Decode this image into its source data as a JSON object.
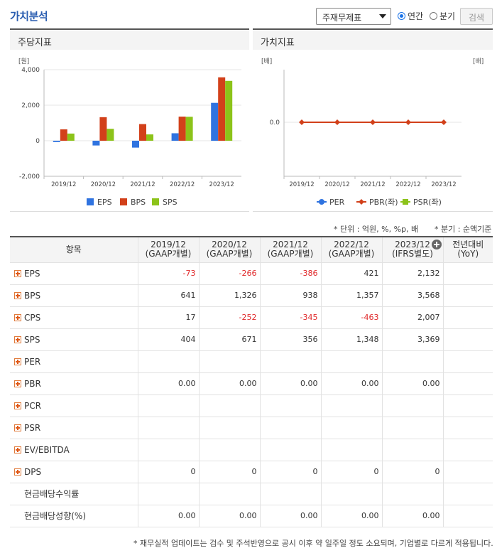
{
  "header": {
    "title": "가치분석",
    "select_value": "주재무제표",
    "radio_annual": "연간",
    "radio_quarter": "분기",
    "search_label": "검색"
  },
  "panels": {
    "left_title": "주당지표",
    "right_title": "가치지표"
  },
  "chart_data": [
    {
      "type": "bar",
      "title": "주당지표",
      "ylabel": "[원]",
      "categories": [
        "2019/12",
        "2020/12",
        "2021/12",
        "2022/12",
        "2023/12"
      ],
      "ylim": [
        -2000,
        4000
      ],
      "yticks": [
        "4,000",
        "2,000",
        "0",
        "-2,000"
      ],
      "ytick_values": [
        4000,
        2000,
        0,
        -2000
      ],
      "series": [
        {
          "name": "EPS",
          "color": "#2f73e0",
          "values": [
            -73,
            -266,
            -386,
            421,
            2132
          ]
        },
        {
          "name": "BPS",
          "color": "#d2401a",
          "values": [
            641,
            1326,
            938,
            1357,
            3568
          ]
        },
        {
          "name": "SPS",
          "color": "#8cc31a",
          "values": [
            404,
            671,
            356,
            1348,
            3369
          ]
        }
      ]
    },
    {
      "type": "line",
      "title": "가치지표",
      "ylabel_left": "[배]",
      "ylabel_right": "[배]",
      "categories": [
        "2019/12",
        "2020/12",
        "2021/12",
        "2022/12",
        "2023/12"
      ],
      "yticks": [
        "0.0"
      ],
      "series": [
        {
          "name": "PER",
          "color": "#2f73e0",
          "values": []
        },
        {
          "name": "PBR(좌)",
          "color": "#d2401a",
          "values": [
            0,
            0,
            0,
            0,
            0
          ]
        },
        {
          "name": "PSR(좌)",
          "color": "#8cc31a",
          "values": []
        }
      ]
    }
  ],
  "notes": {
    "unit": "* 단위 : 억원, %, %p, 배",
    "quarter": "* 분기 : 순액기준"
  },
  "table": {
    "item_header": "항목",
    "columns": [
      {
        "year": "2019/12",
        "basis": "(GAAP개별)"
      },
      {
        "year": "2020/12",
        "basis": "(GAAP개별)"
      },
      {
        "year": "2021/12",
        "basis": "(GAAP개별)"
      },
      {
        "year": "2022/12",
        "basis": "(GAAP개별)"
      },
      {
        "year": "2023/12",
        "basis": "(IFRS별도)"
      }
    ],
    "yoy_header": {
      "line1": "전년대비",
      "line2": "(YoY)"
    },
    "rows": [
      {
        "label": "EPS",
        "expand": true,
        "values": [
          "-73",
          "-266",
          "-386",
          "421",
          "2,132"
        ],
        "yoy": ""
      },
      {
        "label": "BPS",
        "expand": true,
        "values": [
          "641",
          "1,326",
          "938",
          "1,357",
          "3,568"
        ],
        "yoy": ""
      },
      {
        "label": "CPS",
        "expand": true,
        "values": [
          "17",
          "-252",
          "-345",
          "-463",
          "2,007"
        ],
        "yoy": ""
      },
      {
        "label": "SPS",
        "expand": true,
        "values": [
          "404",
          "671",
          "356",
          "1,348",
          "3,369"
        ],
        "yoy": ""
      },
      {
        "label": "PER",
        "expand": true,
        "values": [
          "",
          "",
          "",
          "",
          ""
        ],
        "yoy": ""
      },
      {
        "label": "PBR",
        "expand": true,
        "values": [
          "0.00",
          "0.00",
          "0.00",
          "0.00",
          "0.00"
        ],
        "yoy": ""
      },
      {
        "label": "PCR",
        "expand": true,
        "values": [
          "",
          "",
          "",
          "",
          ""
        ],
        "yoy": ""
      },
      {
        "label": "PSR",
        "expand": true,
        "values": [
          "",
          "",
          "",
          "",
          ""
        ],
        "yoy": ""
      },
      {
        "label": "EV/EBITDA",
        "expand": true,
        "values": [
          "",
          "",
          "",
          "",
          ""
        ],
        "yoy": ""
      },
      {
        "label": "DPS",
        "expand": true,
        "values": [
          "0",
          "0",
          "0",
          "0",
          "0"
        ],
        "yoy": ""
      },
      {
        "label": "현금배당수익률",
        "expand": false,
        "values": [
          "",
          "",
          "",
          "",
          ""
        ],
        "yoy": ""
      },
      {
        "label": "현금배당성향(%)",
        "expand": false,
        "values": [
          "0.00",
          "0.00",
          "0.00",
          "0.00",
          "0.00"
        ],
        "yoy": ""
      }
    ]
  },
  "footnote": "* 재무실적 업데이트는 검수 및 주석반영으로 공시 이후 약 일주일 정도 소요되며, 기업별로 다르게 적용됩니다."
}
